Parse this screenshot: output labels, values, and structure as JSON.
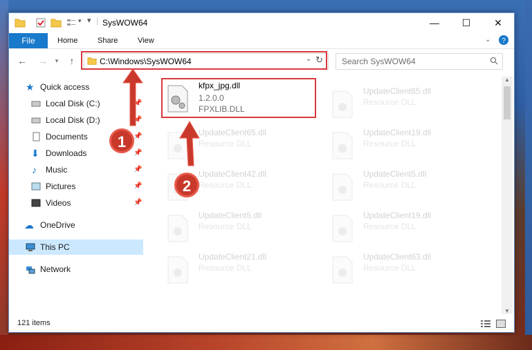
{
  "window": {
    "title": "SysWOW64"
  },
  "ribbon": {
    "file": "File",
    "tabs": [
      "Home",
      "Share",
      "View"
    ]
  },
  "address": {
    "path": "C:\\Windows\\SysWOW64"
  },
  "search": {
    "placeholder": "Search SysWOW64"
  },
  "sidebar": {
    "quick_access": "Quick access",
    "items": [
      "Local Disk (C:)",
      "Local Disk (D:)",
      "Documents",
      "Downloads",
      "Music",
      "Pictures",
      "Videos"
    ],
    "onedrive": "OneDrive",
    "this_pc": "This PC",
    "network": "Network"
  },
  "files": {
    "highlighted": {
      "name": "kfpx_jpg.dll",
      "version": "1.2.0.0",
      "desc": "FPXLIB.DLL"
    },
    "others": [
      {
        "name": "UpdateClient65.dll",
        "desc": "Resource DLL"
      },
      {
        "name": "UpdateClient65.dll",
        "desc": "Resource DLL"
      },
      {
        "name": "UpdateClient19.dll",
        "desc": "Resource DLL"
      },
      {
        "name": "UpdateClient42.dll",
        "desc": "Resource DLL"
      },
      {
        "name": "UpdateClient5.dll",
        "desc": "Resource DLL"
      },
      {
        "name": "UpdateClient5.dll",
        "desc": "Resource DLL"
      },
      {
        "name": "UpdateClient19.dll",
        "desc": "Resource DLL"
      },
      {
        "name": "UpdateClient21.dll",
        "desc": "Resource DLL"
      },
      {
        "name": "UpdateClient63.dll",
        "desc": "Resource DLL"
      }
    ]
  },
  "status": {
    "count": "121 items"
  },
  "callouts": {
    "one": "1",
    "two": "2"
  },
  "colors": {
    "accent": "#1979ca",
    "highlight": "#d9383b",
    "callout": "#c8392b"
  }
}
